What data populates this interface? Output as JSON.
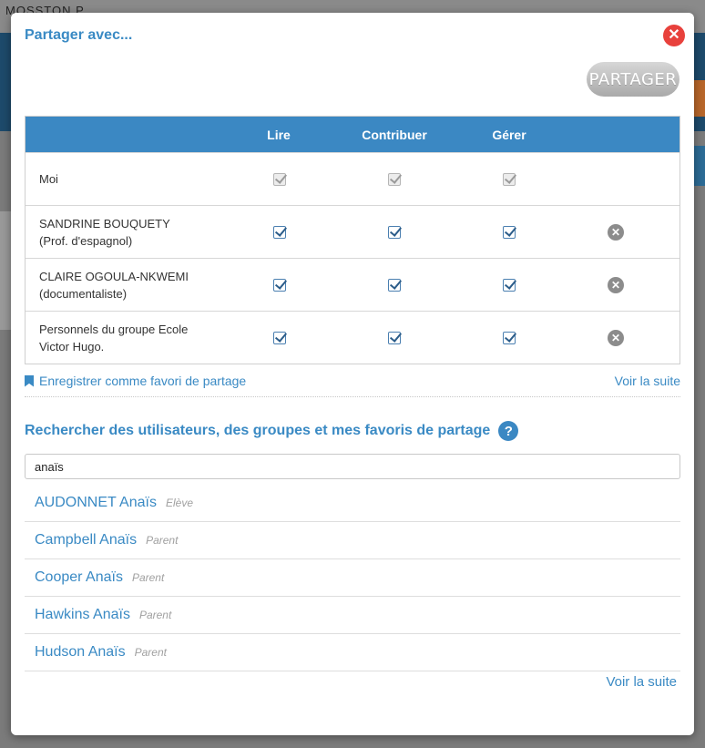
{
  "background": {
    "top_text": "MOSSTON P..."
  },
  "dialog": {
    "title": "Partager avec...",
    "share_button": "PARTAGER",
    "close_icon": "close-icon"
  },
  "table": {
    "headers": [
      "",
      "Lire",
      "Contribuer",
      "Gérer",
      ""
    ],
    "rows": [
      {
        "line1": "Moi",
        "line2": "",
        "lire": true,
        "contribuer": true,
        "gerer": true,
        "locked": true,
        "removable": false
      },
      {
        "line1": "SANDRINE BOUQUETY",
        "line2": "(Prof. d'espagnol)",
        "lire": true,
        "contribuer": true,
        "gerer": true,
        "locked": false,
        "removable": true
      },
      {
        "line1": "CLAIRE OGOULA-NKWEMI",
        "line2": "(documentaliste)",
        "lire": true,
        "contribuer": true,
        "gerer": true,
        "locked": false,
        "removable": true
      },
      {
        "line1": "Personnels du groupe Ecole",
        "line2": "Victor Hugo.",
        "lire": true,
        "contribuer": true,
        "gerer": true,
        "locked": false,
        "removable": true
      }
    ]
  },
  "favorites": {
    "save_label": "Enregistrer comme favori de partage",
    "more_label": "Voir la suite"
  },
  "search": {
    "title": "Rechercher des utilisateurs, des groupes et mes favoris de partage",
    "value": "anaïs",
    "results": [
      {
        "name": "AUDONNET Anaïs",
        "role": "Elève"
      },
      {
        "name": "Campbell Anaïs",
        "role": "Parent"
      },
      {
        "name": "Cooper Anaïs",
        "role": "Parent"
      },
      {
        "name": "Hawkins Anaïs",
        "role": "Parent"
      },
      {
        "name": "Hudson Anaïs",
        "role": "Parent"
      }
    ],
    "more_label": "Voir la suite"
  },
  "colors": {
    "accent": "#3a8ac4",
    "header_bg": "#3b88c3",
    "close": "#e8413c"
  }
}
